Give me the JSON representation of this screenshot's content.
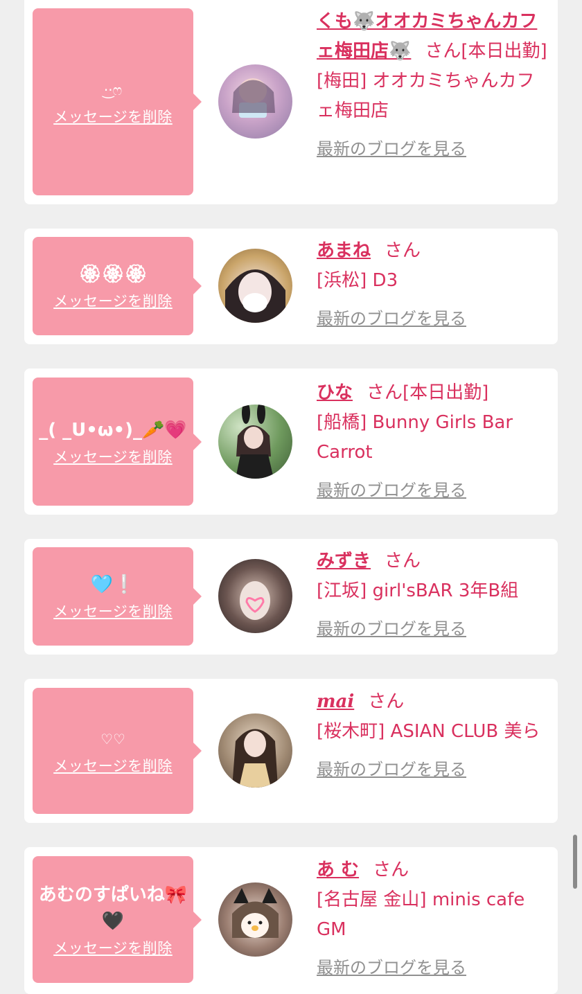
{
  "cards": [
    {
      "message": "·͜·ෆ",
      "delete_label": "メッセージを削除",
      "name": "くも🐺オオカミちゃんカフェ梅田店🐺",
      "san": "さん",
      "status": "[本日出勤]",
      "shop": "[梅田] オオカミちゃんカフェ梅田店",
      "blog_label": "最新のブログを見る"
    },
    {
      "message": "🏵🏵🏵",
      "delete_label": "メッセージを削除",
      "name": "あまね",
      "san": "さん",
      "status": "",
      "shop": "[浜松] D3",
      "blog_label": "最新のブログを見る"
    },
    {
      "message": "_( _U•ω•)_🥕💗",
      "delete_label": "メッセージを削除",
      "name": "ひな",
      "san": "さん",
      "status": "[本日出勤]",
      "shop": "[船橋] Bunny Girls Bar Carrot",
      "blog_label": "最新のブログを見る"
    },
    {
      "message": "🩵❕",
      "delete_label": "メッセージを削除",
      "name": "みずき",
      "san": "さん",
      "status": "",
      "shop": "[江坂] girl'sBAR 3年B組",
      "blog_label": "最新のブログを見る"
    },
    {
      "message": "♡♡",
      "delete_label": "メッセージを削除",
      "name": "mai",
      "san": "さん",
      "status": "",
      "shop": "[桜木町] ASIAN CLUB 美ら",
      "blog_label": "最新のブログを見る"
    },
    {
      "message": "あむのすぱいね🎀🖤",
      "delete_label": "メッセージを削除",
      "name": "あ む",
      "san": "さん",
      "status": "",
      "shop": "[名古屋 金山] minis cafe GM",
      "blog_label": "最新のブログを見る"
    }
  ],
  "colors": {
    "accent": "#d9305e",
    "bubble": "#f79aa9",
    "muted_link": "#909090",
    "background": "#efefef"
  }
}
